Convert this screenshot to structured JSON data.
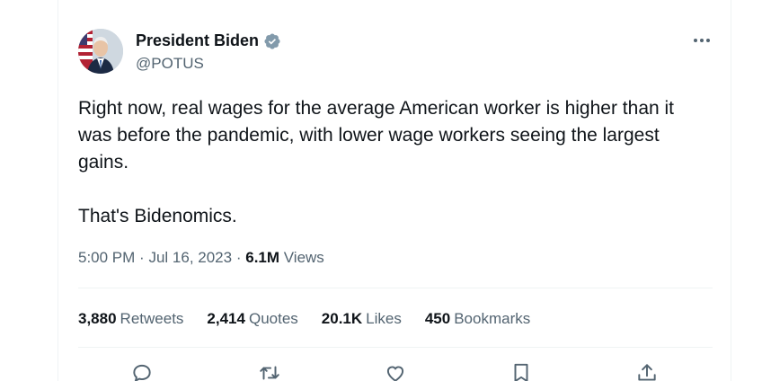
{
  "tweet": {
    "author": {
      "display_name": "President Biden",
      "handle": "@POTUS",
      "verified_icon": "verified-badge-icon"
    },
    "text": "Right now, real wages for the average American worker is higher than it\nwas before the pandemic, with lower wage workers seeing the largest\ngains.\n\nThat's Bidenomics.",
    "meta": {
      "time": "5:00 PM",
      "separator": "·",
      "date": "Jul 16, 2023",
      "views_count": "6.1M",
      "views_label": "Views"
    },
    "stats": [
      {
        "count": "3,880",
        "label": "Retweets"
      },
      {
        "count": "2,414",
        "label": "Quotes"
      },
      {
        "count": "20.1K",
        "label": "Likes"
      },
      {
        "count": "450",
        "label": "Bookmarks"
      }
    ],
    "actions": [
      "reply-icon",
      "retweet-icon",
      "like-icon",
      "bookmark-icon",
      "share-icon"
    ]
  },
  "colors": {
    "text_primary": "#0f1419",
    "text_secondary": "#536471",
    "verified": "#829aab",
    "divider": "#eff3f4"
  }
}
